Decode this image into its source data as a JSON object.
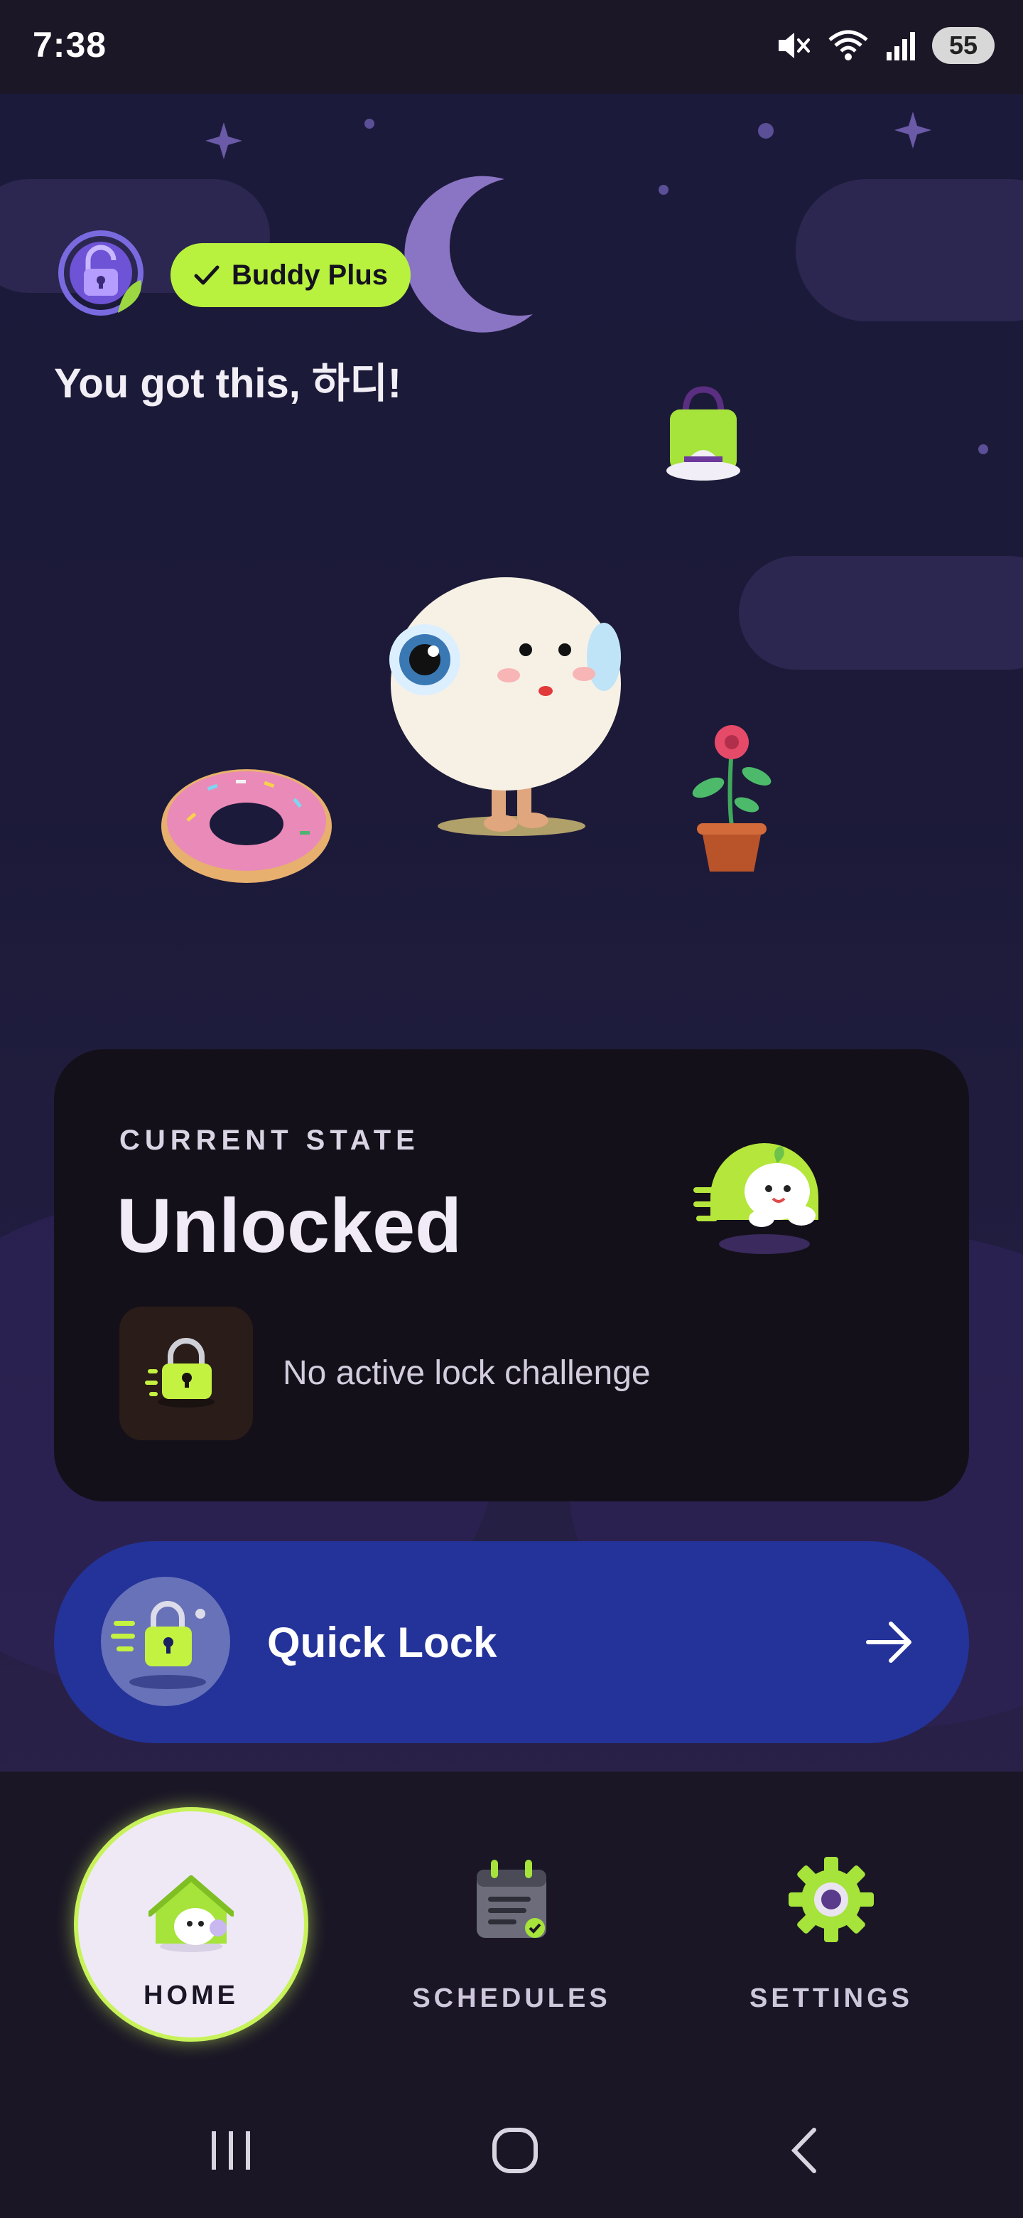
{
  "status_bar": {
    "time": "7:38",
    "battery": "55",
    "icons": [
      "mute-icon",
      "wifi-icon",
      "signal-icon",
      "battery-icon"
    ]
  },
  "header": {
    "badge_label": "Buddy Plus",
    "greeting": "You got this, 하디!"
  },
  "state_card": {
    "label": "CURRENT STATE",
    "value": "Unlocked",
    "challenge_text": "No active lock challenge"
  },
  "quick_lock": {
    "label": "Quick Lock"
  },
  "bottom_nav": {
    "items": [
      {
        "label": "HOME",
        "active": true
      },
      {
        "label": "SCHEDULES",
        "active": false
      },
      {
        "label": "SETTINGS",
        "active": false
      }
    ]
  },
  "colors": {
    "accent": "#b8f23e",
    "quick_lock_bg": "#24339a",
    "card_bg": "#141019",
    "scene_bg": "#1c1a3a"
  }
}
